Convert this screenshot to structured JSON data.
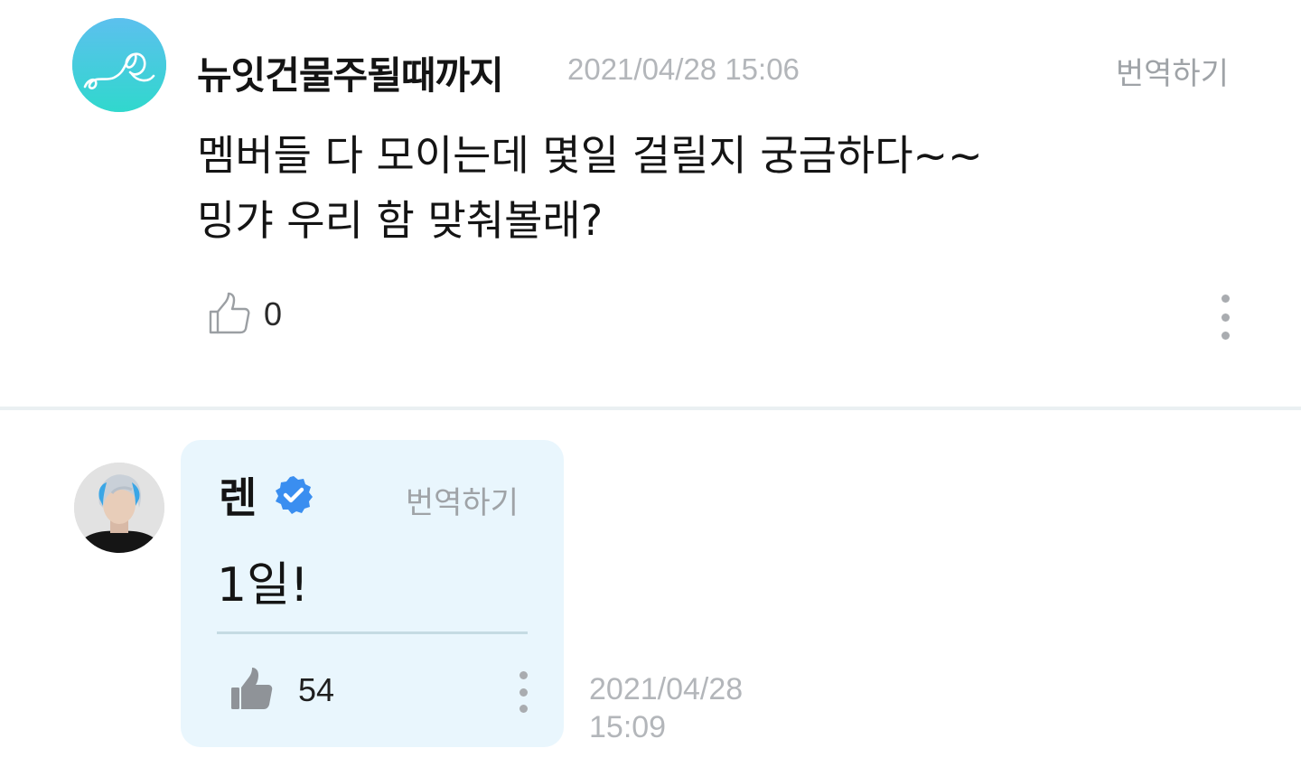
{
  "fan_comment": {
    "author": "뉴잇건물주될때까지",
    "timestamp": "2021/04/28 15:06",
    "translate_label": "번역하기",
    "body_lines": [
      "멤버들 다 모이는데 몇일 걸릴지 궁금하다~~",
      "밍갸 우리 함 맞춰볼래?"
    ],
    "like_count": "0",
    "like_icon": "thumbs-up-outline-icon",
    "more_icon": "more-vertical-icon",
    "avatar_colors": [
      "#5cc0ee",
      "#34d6cf"
    ]
  },
  "artist_reply": {
    "author": "렌",
    "verified_icon": "verified-badge-icon",
    "translate_label": "번역하기",
    "body": "1일!",
    "like_count": "54",
    "like_icon": "thumbs-up-filled-icon",
    "more_icon": "more-vertical-icon",
    "timestamp_date": "2021/04/28",
    "timestamp_time": "15:09",
    "bubble_color": "#e9f6fd",
    "verified_color": "#3a8ef0"
  }
}
